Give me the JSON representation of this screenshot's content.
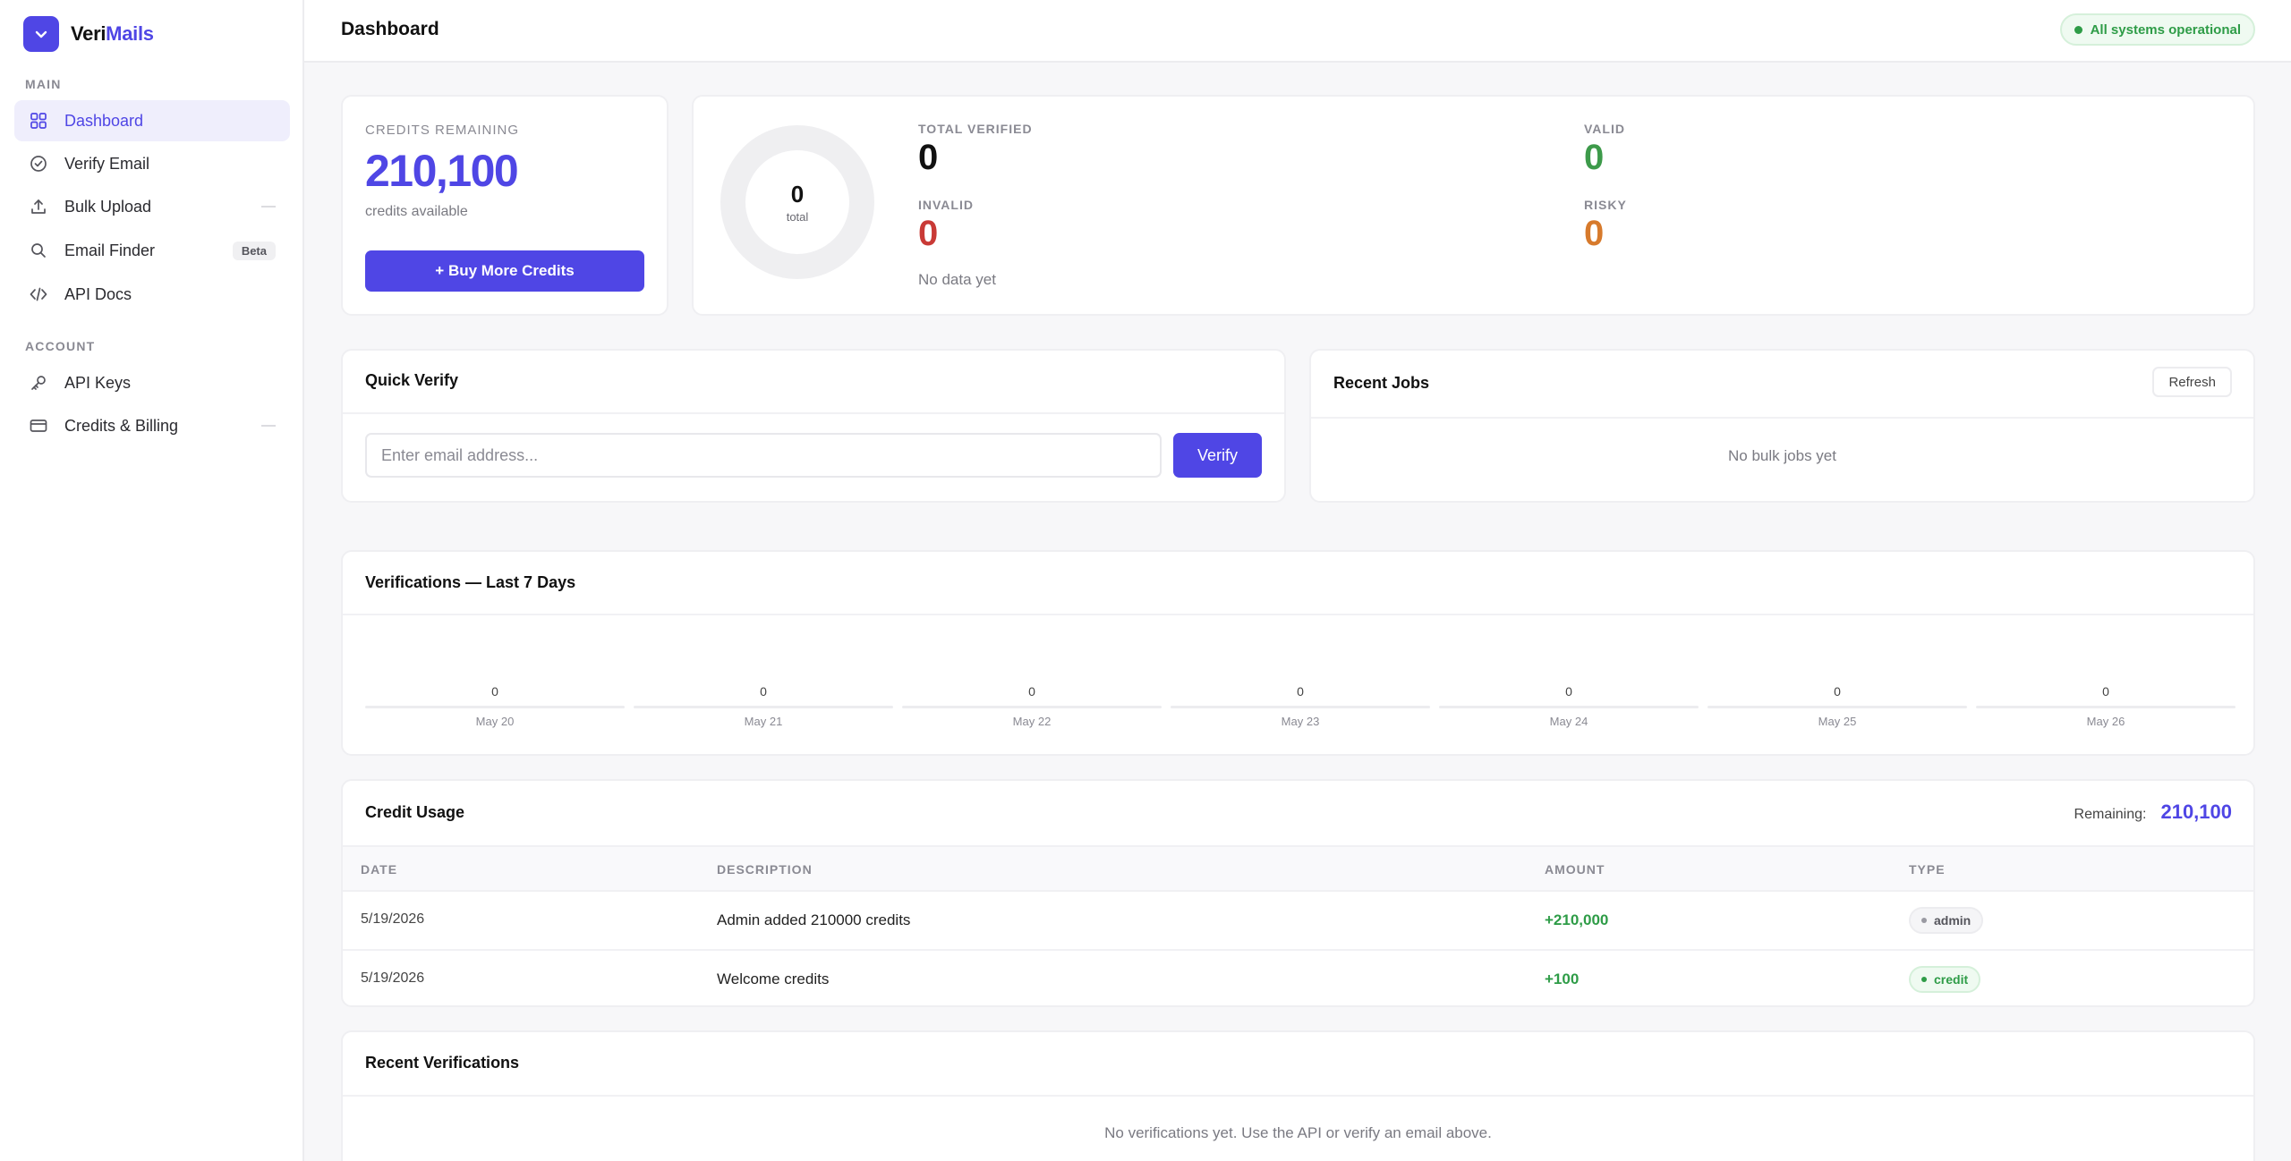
{
  "app": {
    "name_prefix": "Veri",
    "name_suffix": "Mails"
  },
  "sidebar": {
    "sections": [
      {
        "label": "MAIN"
      },
      {
        "label": "ACCOUNT"
      }
    ],
    "items": [
      {
        "label": "Dashboard",
        "icon": "grid-icon",
        "active": true
      },
      {
        "label": "Verify Email",
        "icon": "check-circle-icon"
      },
      {
        "label": "Bulk Upload",
        "icon": "upload-icon"
      },
      {
        "label": "Email Finder",
        "icon": "search-icon",
        "badge": "Beta"
      },
      {
        "label": "API Docs",
        "icon": "code-icon"
      },
      {
        "label": "API Keys",
        "icon": "key-icon"
      },
      {
        "label": "Credits & Billing",
        "icon": "credit-card-icon"
      }
    ]
  },
  "header": {
    "title": "Dashboard",
    "status": "All systems operational"
  },
  "credits": {
    "label": "CREDITS REMAINING",
    "value": "210,100",
    "sub": "credits available",
    "buy_label": "+ Buy More Credits"
  },
  "summary": {
    "donut_value": "0",
    "donut_label": "total",
    "total_verified_label": "TOTAL VERIFIED",
    "total_verified": "0",
    "invalid_label": "INVALID",
    "invalid": "0",
    "valid_label": "VALID",
    "valid": "0",
    "risky_label": "RISKY",
    "risky": "0",
    "no_data": "No data yet",
    "colors": {
      "valid": "#3d9a4a",
      "invalid": "#c93a36",
      "risky": "#d77a2c",
      "neutral": "#111111"
    }
  },
  "quick_verify": {
    "title": "Quick Verify",
    "placeholder": "Enter email address...",
    "button": "Verify"
  },
  "recent_jobs": {
    "title": "Recent Jobs",
    "refresh": "Refresh",
    "empty": "No bulk jobs yet"
  },
  "chart": {
    "title": "Verifications — Last 7 Days"
  },
  "chart_data": {
    "type": "bar",
    "title": "Verifications — Last 7 Days",
    "categories": [
      "May 20",
      "May 21",
      "May 22",
      "May 23",
      "May 24",
      "May 25",
      "May 26"
    ],
    "values": [
      0,
      0,
      0,
      0,
      0,
      0,
      0
    ],
    "value_labels": [
      "0",
      "0",
      "0",
      "0",
      "0",
      "0",
      "0"
    ]
  },
  "credit_usage": {
    "title": "Credit Usage",
    "remaining_label": "Remaining:",
    "remaining_value": "210,100",
    "columns": [
      "DATE",
      "DESCRIPTION",
      "AMOUNT",
      "TYPE"
    ],
    "rows": [
      {
        "date": "5/19/2026",
        "description": "Admin added 210000 credits",
        "amount": "+210,000",
        "type": "admin"
      },
      {
        "date": "5/19/2026",
        "description": "Welcome credits",
        "amount": "+100",
        "type": "credit"
      }
    ]
  },
  "recent_verifications": {
    "title": "Recent Verifications",
    "empty": "No verifications yet. Use the API or verify an email above."
  },
  "accent_color": "#4f46e5"
}
